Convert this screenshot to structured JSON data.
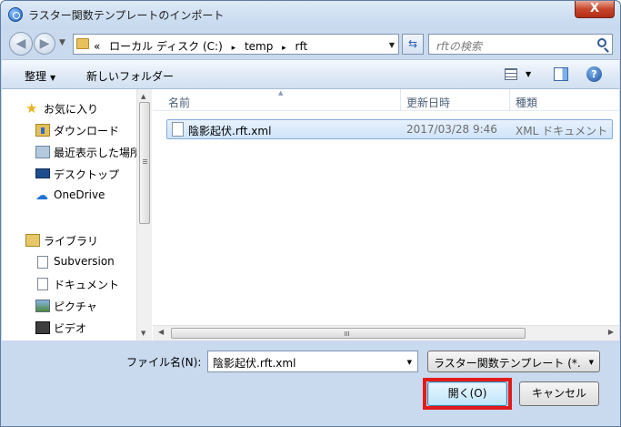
{
  "window": {
    "title": "ラスター関数テンプレートのインポート",
    "close_label": "X"
  },
  "address": {
    "prefix": "«",
    "segments": [
      "ローカル ディスク (C:)",
      "temp",
      "rft"
    ],
    "separator": "▸"
  },
  "search": {
    "placeholder": "rftの検索"
  },
  "toolbar": {
    "organize": "整理",
    "organize_caret": "▼",
    "new_folder": "新しいフォルダー",
    "view_caret": "▼",
    "help": "?"
  },
  "sidebar": {
    "favorites": {
      "label": "お気に入り",
      "items": [
        {
          "label": "ダウンロード",
          "icon": "download-folder-icon"
        },
        {
          "label": "最近表示した場所",
          "icon": "recent-places-icon"
        },
        {
          "label": "デスクトップ",
          "icon": "desktop-icon"
        },
        {
          "label": "OneDrive",
          "icon": "cloud-icon"
        }
      ]
    },
    "libraries": {
      "label": "ライブラリ",
      "items": [
        {
          "label": "Subversion",
          "icon": "document-icon"
        },
        {
          "label": "ドキュメント",
          "icon": "document-icon"
        },
        {
          "label": "ピクチャ",
          "icon": "picture-icon"
        },
        {
          "label": "ビデオ",
          "icon": "video-icon"
        }
      ]
    }
  },
  "file_list": {
    "columns": {
      "name": "名前",
      "modified": "更新日時",
      "type": "種類"
    },
    "rows": [
      {
        "name": "陰影起伏.rft.xml",
        "modified": "2017/03/28 9:46",
        "type": "XML ドキュメント"
      }
    ]
  },
  "form": {
    "filename_label": "ファイル名(N):",
    "filename_value": "陰影起伏.rft.xml",
    "filter_value": "ラスター関数テンプレート (*.",
    "open_button": "開く(O)",
    "cancel_button": "キャンセル",
    "dropdown_caret": "▼"
  },
  "colors": {
    "highlight": "#e21b1b",
    "selection": "#cfe3fa",
    "accent": "#3c7fb1"
  }
}
